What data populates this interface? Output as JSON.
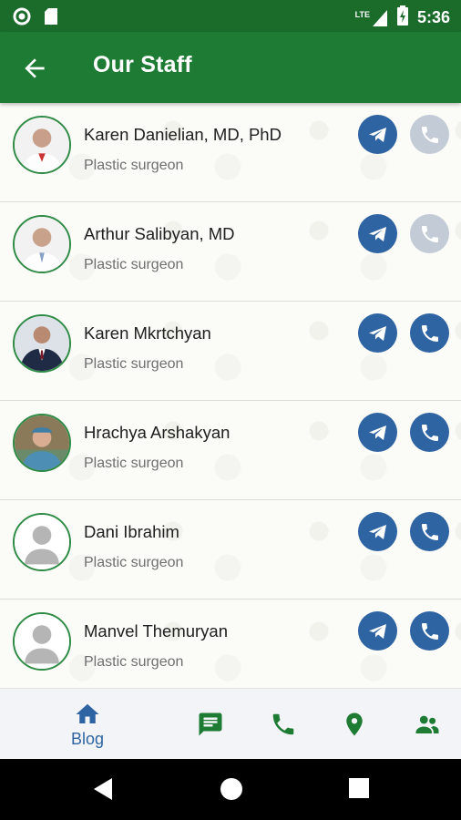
{
  "status_bar": {
    "network": "LTE",
    "time": "5:36"
  },
  "app_bar": {
    "title": "Our Staff"
  },
  "staff": [
    {
      "name": "Karen Danielian, MD, PhD",
      "role": "Plastic surgeon",
      "call_enabled": false,
      "avatar": "photo"
    },
    {
      "name": "Arthur Salibyan, MD",
      "role": "Plastic surgeon",
      "call_enabled": false,
      "avatar": "photo"
    },
    {
      "name": "Karen Mkrtchyan",
      "role": "Plastic surgeon",
      "call_enabled": true,
      "avatar": "photo"
    },
    {
      "name": "Hrachya Arshakyan",
      "role": "Plastic surgeon",
      "call_enabled": true,
      "avatar": "photo"
    },
    {
      "name": "Dani Ibrahim",
      "role": "Plastic surgeon",
      "call_enabled": true,
      "avatar": "placeholder"
    },
    {
      "name": "Manvel Themuryan",
      "role": "Plastic surgeon",
      "call_enabled": true,
      "avatar": "placeholder"
    }
  ],
  "bottom_nav": {
    "blog_label": "Blog",
    "items": [
      "home-icon",
      "message-icon",
      "phone-icon",
      "location-icon",
      "people-icon"
    ]
  },
  "colors": {
    "primary_green": "#1e7b33",
    "accent_blue": "#2f64a3",
    "disabled": "#c3ccd6"
  }
}
